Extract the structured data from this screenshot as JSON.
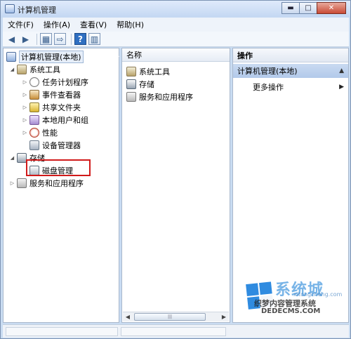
{
  "window": {
    "title": "计算机管理"
  },
  "window_buttons": {
    "minimize": "▬",
    "maximize": "□",
    "close": "✕"
  },
  "menubar": [
    {
      "label": "文件(F)"
    },
    {
      "label": "操作(A)"
    },
    {
      "label": "查看(V)"
    },
    {
      "label": "帮助(H)"
    }
  ],
  "toolbar": {
    "back_icon": "left-arrow-icon",
    "forward_icon": "right-arrow-icon",
    "help_label": "?"
  },
  "tree": {
    "root": "计算机管理(本地)",
    "system_tools": "系统工具",
    "items": [
      {
        "label": "任务计划程序",
        "icon": "clock-icon"
      },
      {
        "label": "事件查看器",
        "icon": "event-viewer-icon"
      },
      {
        "label": "共享文件夹",
        "icon": "shared-folder-icon"
      },
      {
        "label": "本地用户和组",
        "icon": "users-icon"
      },
      {
        "label": "性能",
        "icon": "performance-icon"
      },
      {
        "label": "设备管理器",
        "icon": "device-manager-icon"
      }
    ],
    "storage": "存储",
    "disk_management": "磁盘管理",
    "services": "服务和应用程序"
  },
  "middle": {
    "header": "名称",
    "items": [
      {
        "label": "系统工具"
      },
      {
        "label": "存储"
      },
      {
        "label": "服务和应用程序"
      }
    ]
  },
  "actions": {
    "header": "操作",
    "section_title": "计算机管理(本地)",
    "more": "更多操作"
  },
  "watermark": {
    "brand": "系统城",
    "line1": "织梦内容管理系统",
    "line2": "DEDECMS.COM",
    "line3": "xitongcheng.com"
  }
}
